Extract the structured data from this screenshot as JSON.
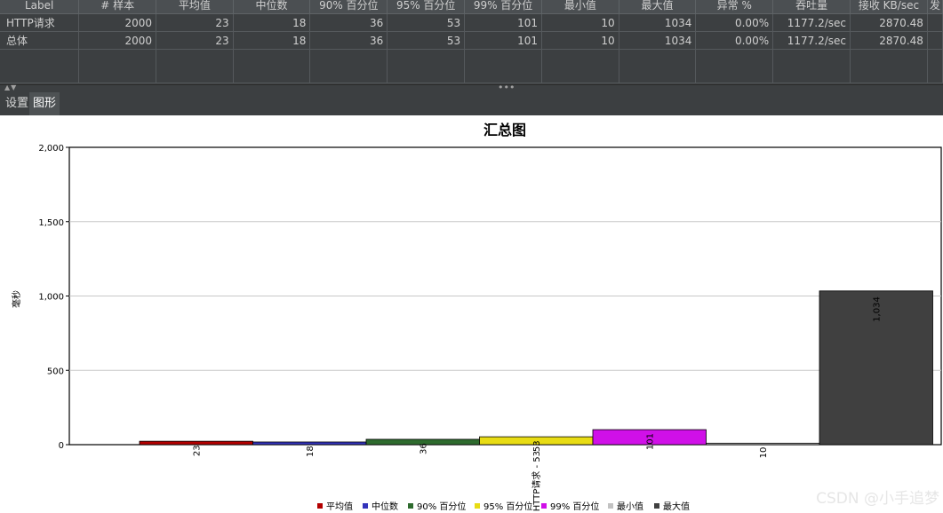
{
  "table": {
    "columns": [
      "Label",
      "# 样本",
      "平均值",
      "中位数",
      "90% 百分位",
      "95% 百分位",
      "99% 百分位",
      "最小值",
      "最大值",
      "异常 %",
      "吞吐量",
      "接收 KB/sec",
      "发"
    ],
    "rows": [
      [
        "HTTP请求",
        "2000",
        "23",
        "18",
        "36",
        "53",
        "101",
        "10",
        "1034",
        "0.00%",
        "1177.2/sec",
        "2870.48",
        ""
      ],
      [
        "总体",
        "2000",
        "23",
        "18",
        "36",
        "53",
        "101",
        "10",
        "1034",
        "0.00%",
        "1177.2/sec",
        "2870.48",
        ""
      ]
    ]
  },
  "divider": {
    "arrows": "▲▼",
    "grip": "•••"
  },
  "tabs": {
    "settings": "设置",
    "graph": "图形"
  },
  "chart_data": {
    "type": "bar",
    "title": "汇总图",
    "ylabel": "毫秒",
    "category_label": "HTTP请求 - 53",
    "ylim": [
      0,
      2000
    ],
    "yticks": [
      "0",
      "500",
      "1,000",
      "1,500",
      "2,000"
    ],
    "grid": true,
    "legend_position": "bottom",
    "series": [
      {
        "name": "平均值",
        "value": 23,
        "label": "23",
        "color": "#b30000"
      },
      {
        "name": "中位数",
        "value": 18,
        "label": "18",
        "color": "#3333bb"
      },
      {
        "name": "90% 百分位",
        "value": 36,
        "label": "36",
        "color": "#2e6b2e"
      },
      {
        "name": "95% 百分位",
        "value": 53,
        "label": "53",
        "color": "#e8dc14"
      },
      {
        "name": "99% 百分位",
        "value": 101,
        "label": "101",
        "color": "#d010e8"
      },
      {
        "name": "最小值",
        "value": 10,
        "label": "10",
        "color": "#c2c2c2"
      },
      {
        "name": "最大值",
        "value": 1034,
        "label": "1,034",
        "color": "#404040"
      }
    ]
  },
  "watermark": "CSDN @小手追梦"
}
